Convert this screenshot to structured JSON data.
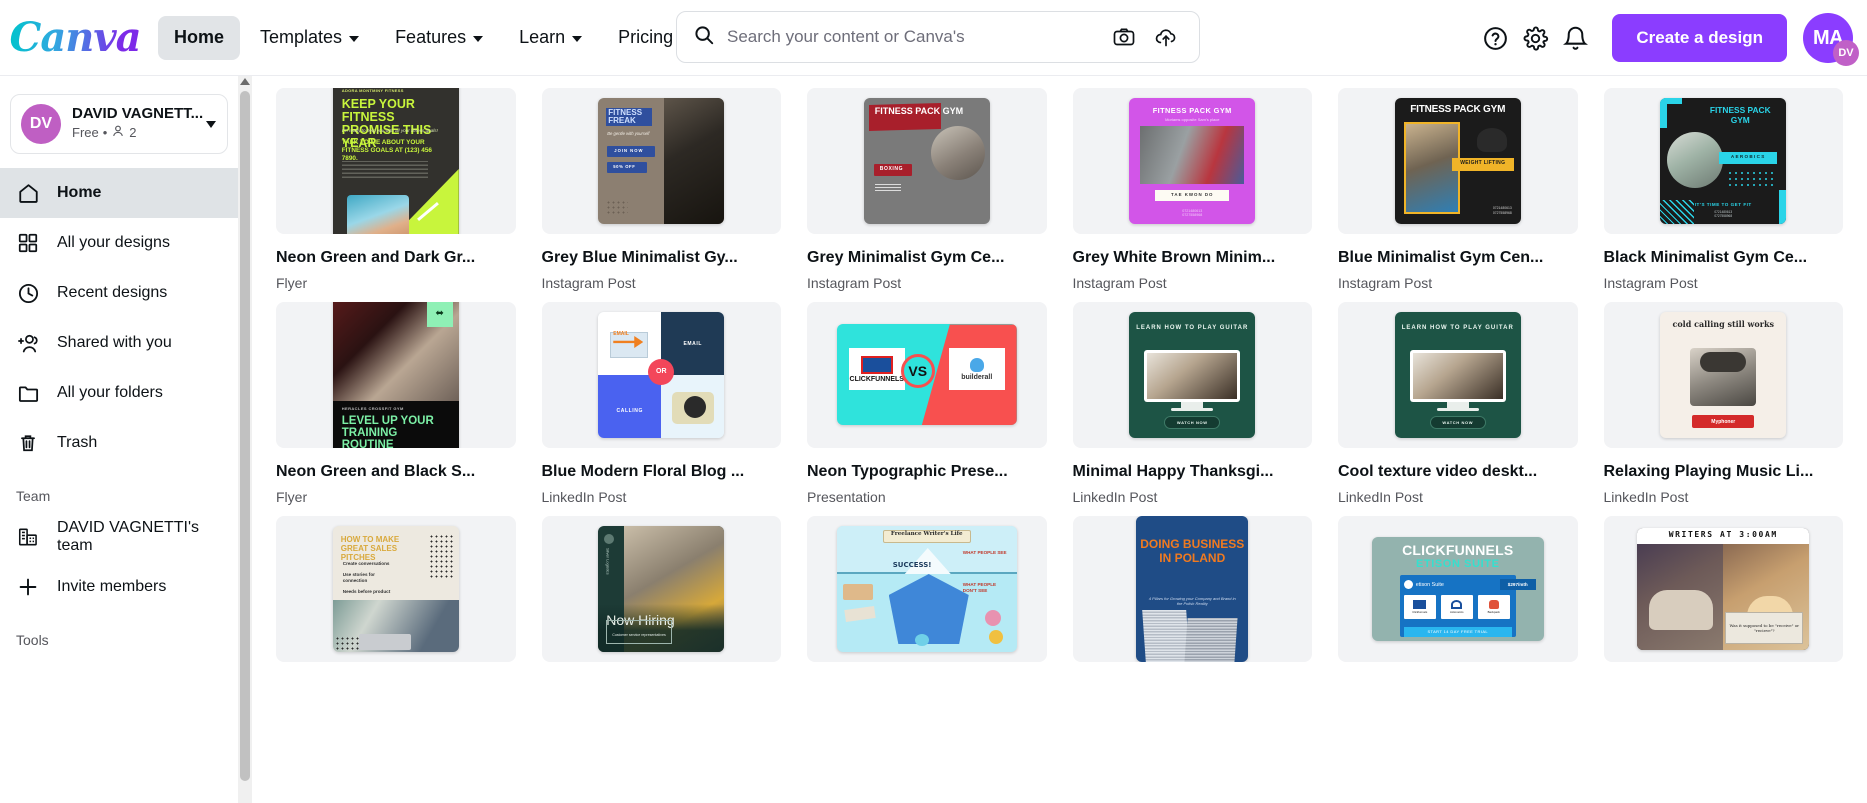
{
  "header": {
    "logo_text": "Canva",
    "nav": [
      {
        "label": "Home",
        "has_caret": false,
        "active": true
      },
      {
        "label": "Templates",
        "has_caret": true,
        "active": false
      },
      {
        "label": "Features",
        "has_caret": true,
        "active": false
      },
      {
        "label": "Learn",
        "has_caret": true,
        "active": false
      },
      {
        "label": "Pricing",
        "has_caret": true,
        "active": false
      }
    ],
    "search": {
      "placeholder": "Search your content or Canva's",
      "value": ""
    },
    "search_icons": [
      "search-icon",
      "camera-icon",
      "cloud-upload-icon"
    ],
    "right_icons": [
      "help-icon",
      "gear-icon",
      "bell-icon"
    ],
    "create_button": "Create a design",
    "avatar": {
      "initials": "MA",
      "badge": "DV"
    },
    "accent_color": "#8b3dff"
  },
  "sidebar": {
    "user": {
      "initials": "DV",
      "name": "DAVID VAGNETT...",
      "plan": "Free",
      "separator": "•",
      "member_count": "2"
    },
    "items": [
      {
        "label": "Home",
        "icon": "home-icon",
        "selected": true
      },
      {
        "label": "All your designs",
        "icon": "grid-icon",
        "selected": false
      },
      {
        "label": "Recent designs",
        "icon": "clock-icon",
        "selected": false
      },
      {
        "label": "Shared with you",
        "icon": "people-add-icon",
        "selected": false
      },
      {
        "label": "All your folders",
        "icon": "folder-icon",
        "selected": false
      },
      {
        "label": "Trash",
        "icon": "trash-icon",
        "selected": false
      }
    ],
    "team_section_label": "Team",
    "team_items": [
      {
        "label": "DAVID VAGNETTI's team",
        "icon": "building-icon"
      },
      {
        "label": "Invite members",
        "icon": "plus-icon"
      }
    ],
    "tools_section_label": "Tools"
  },
  "designs": [
    {
      "title": "Neon Green and Dark Gr...",
      "type": "Flyer",
      "art": "neon-fitness-flyer"
    },
    {
      "title": "Grey Blue Minimalist Gy...",
      "type": "Instagram Post",
      "art": "fitness-freak"
    },
    {
      "title": "Grey Minimalist Gym Ce...",
      "type": "Instagram Post",
      "art": "boxing-gym"
    },
    {
      "title": "Grey White Brown Minim...",
      "type": "Instagram Post",
      "art": "taekwondo-pink"
    },
    {
      "title": "Blue Minimalist Gym Cen...",
      "type": "Instagram Post",
      "art": "weight-lifting"
    },
    {
      "title": "Black Minimalist Gym Ce...",
      "type": "Instagram Post",
      "art": "aerobics-teal"
    },
    {
      "title": "Neon Green and Black S...",
      "type": "Flyer",
      "art": "level-up-training"
    },
    {
      "title": "Blue Modern Floral Blog ...",
      "type": "LinkedIn Post",
      "art": "email-or-calling"
    },
    {
      "title": "Neon Typographic Prese...",
      "type": "Presentation",
      "art": "clickfunnels-vs"
    },
    {
      "title": "Minimal Happy Thanksgi...",
      "type": "LinkedIn Post",
      "art": "guitar-green"
    },
    {
      "title": "Cool texture video deskt...",
      "type": "LinkedIn Post",
      "art": "guitar-green"
    },
    {
      "title": "Relaxing Playing Music Li...",
      "type": "LinkedIn Post",
      "art": "cold-calling"
    },
    {
      "title": "",
      "type": "",
      "art": "sales-pitches"
    },
    {
      "title": "",
      "type": "",
      "art": "now-hiring"
    },
    {
      "title": "",
      "type": "",
      "art": "freelance-iceberg"
    },
    {
      "title": "",
      "type": "",
      "art": "poland-business"
    },
    {
      "title": "",
      "type": "",
      "art": "etison-suite"
    },
    {
      "title": "",
      "type": "",
      "art": "writers-3am"
    }
  ],
  "thumbnail_text": {
    "neon-fitness-flyer": {
      "brand": "ADORA MONTMINY FITNESS",
      "headline": "KEEP YOUR FITNESS PROMISE THIS YEAR",
      "sub": "I'm ready to help you with all your fitness goals!",
      "cta": "TALK TO ME ABOUT YOUR FITNESS GOALS AT (123) 456 7890."
    },
    "fitness-freak": {
      "title": "FITNESS FREAK",
      "sub": "Be gentle with yourself",
      "btn1": "JOIN NOW",
      "btn2": "50% OFF"
    },
    "boxing-gym": {
      "title": "FITNESS PACK GYM",
      "tag": "BOXING"
    },
    "taekwondo-pink": {
      "title": "FITNESS PACK GYM",
      "sub": "Moriams opposite Sam's place",
      "tag": "TAE KWON DO"
    },
    "weight-lifting": {
      "title": "FITNESS PACK GYM",
      "tag": "WEIGHT LIFTING"
    },
    "aerobics-teal": {
      "title": "FITNESS PACK GYM",
      "tag": "AEROBICS",
      "footer": "IT'S TIME TO GET FIT"
    },
    "level-up-training": {
      "brand": "HERACLES CROSSFIT GYM",
      "headline": "LEVEL UP YOUR TRAINING ROUTINE"
    },
    "email-or-calling": {
      "a": "EMAIL",
      "b": "EMAIL",
      "c": "CALLING",
      "or": "OR"
    },
    "clickfunnels-vs": {
      "left": "CLICKFUNNELS",
      "vs": "VS",
      "right": "builderall"
    },
    "guitar-green": {
      "title": "LEARN HOW TO PLAY GUITAR",
      "btn": "WATCH NOW"
    },
    "cold-calling": {
      "title": "cold calling still works",
      "brand": "Myphoner"
    },
    "sales-pitches": {
      "title": "HOW TO MAKE GREAT SALES PITCHES",
      "b1": "Create conversations",
      "b2": "Use stories for connection",
      "b3": "Needs before product"
    },
    "now-hiring": {
      "title": "Now Hiring",
      "sub": "Customer service representatives",
      "brand": "Silver Logistics"
    },
    "freelance-iceberg": {
      "title": "Freelance Writer's Life",
      "success": "SUCCESS!",
      "see": "WHAT PEOPLE SEE",
      "dontsee": "WHAT PEOPLE DON'T SEE"
    },
    "poland-business": {
      "title": "DOING BUSINESS IN POLAND",
      "sub": "4 Pillars for Growing your Company and Brand in the Polish Reality"
    },
    "etison-suite": {
      "title": "CLICKFUNNELS",
      "sub": "ETISON SUITE",
      "price": "$297/mth",
      "btn": "START 14 DAY FREE TRIAL",
      "i1": "Clickfunnels",
      "i2": "Actionetics",
      "i3": "Backpack",
      "logo": "etison Suite"
    },
    "writers-3am": {
      "title": "WRITERS AT 3:00AM",
      "caption": "Was it supposed to be \"receive\" or \"recieve\"?"
    }
  }
}
